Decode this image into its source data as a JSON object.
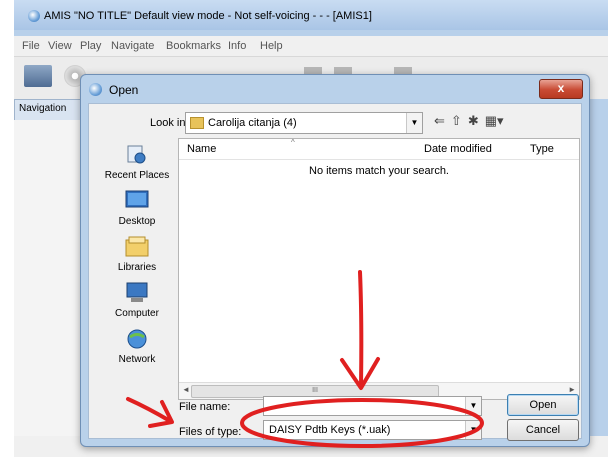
{
  "app": {
    "window_title": "AMIS \"NO TITLE\" Default view mode - Not self-voicing - - - [AMIS1]",
    "menu": [
      "File",
      "View",
      "Play",
      "Navigate",
      "Bookmarks",
      "Info",
      "Help"
    ],
    "nav_panel_label": "Navigation"
  },
  "dialog": {
    "title": "Open",
    "close_symbol": "x",
    "look_in_label": "Look in:",
    "look_in_value": "Carolija citanja (4)",
    "places": [
      {
        "label": "Recent Places",
        "icon": "recent-places-icon"
      },
      {
        "label": "Desktop",
        "icon": "desktop-icon"
      },
      {
        "label": "Libraries",
        "icon": "libraries-icon"
      },
      {
        "label": "Computer",
        "icon": "computer-icon"
      },
      {
        "label": "Network",
        "icon": "network-icon"
      }
    ],
    "columns": {
      "name": "Name",
      "date_modified": "Date modified",
      "type": "Type"
    },
    "empty_message": "No items match your search.",
    "scroll_thumb_grip": "III",
    "file_name_label": "File name:",
    "file_name_value": "",
    "files_of_type_label": "Files of type:",
    "files_of_type_value": "DAISY Pdtb Keys (*.uak)",
    "open_button": "Open",
    "cancel_button": "Cancel"
  },
  "annotation": {
    "color": "#e02020"
  }
}
